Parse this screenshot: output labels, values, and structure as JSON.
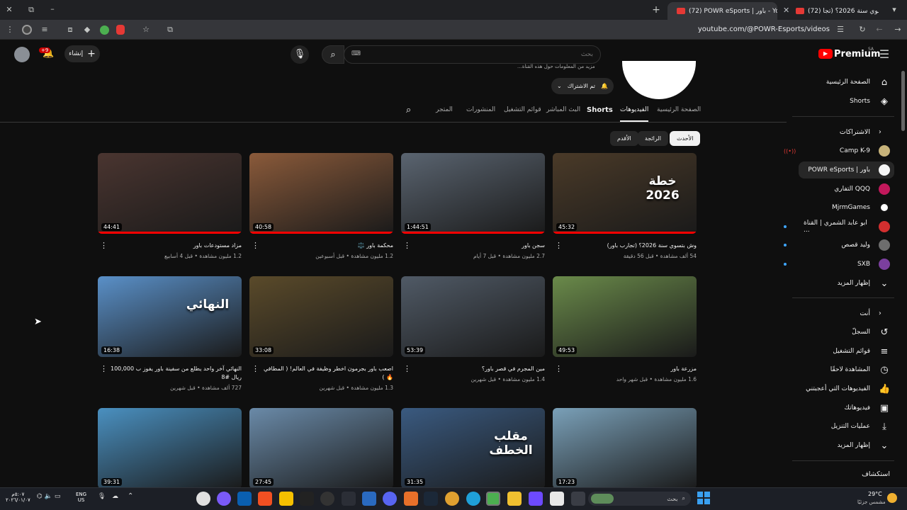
{
  "browser": {
    "tabs": [
      {
        "title": "(72) وش بتسوي سنة 2026؟ (تجا"
      },
      {
        "title": "(72) POWR eSports | باور - YouT"
      }
    ],
    "url": "youtube.com/@POWR-Esports/videos",
    "icons": [
      "back-icon",
      "reload-icon",
      "tab-search-icon",
      "star-icon",
      "extensions-icon"
    ]
  },
  "masthead": {
    "logo": "Premium",
    "logo_sup": "SA",
    "search_placeholder": "بحث",
    "search_kbd": "⌨",
    "create_label": "إنشاء",
    "notif_count": "+9"
  },
  "sidebar": {
    "main": [
      {
        "label": "الصفحة الرئيسية",
        "icon": "home-icon"
      },
      {
        "label": "Shorts",
        "icon": "shorts-icon"
      }
    ],
    "subs_header": "الاشتراكات",
    "subs": [
      {
        "label": "Camp K-9",
        "live": true,
        "dot": false,
        "color": "#c7b37a"
      },
      {
        "label": "POWR eSports | باور",
        "live": false,
        "dot": false,
        "color": "#f5f5f5"
      },
      {
        "label": "التفاري QQQ",
        "live": false,
        "dot": false,
        "color": "#c2185b"
      },
      {
        "label": "MjrmGames",
        "live": false,
        "dot": false,
        "color": "#ffffff"
      },
      {
        "label": "ابو عابد الشمري | القناة ...",
        "live": false,
        "dot": true,
        "color": "#d32f2f"
      },
      {
        "label": "وليد قصص",
        "live": false,
        "dot": true,
        "color": "#6d6d6d"
      },
      {
        "label": "SXB",
        "live": false,
        "dot": true,
        "color": "#7b3f9e"
      }
    ],
    "subs_more": "إظهار المزيد",
    "you_header": "أنت",
    "you": [
      {
        "label": "السجلّ",
        "icon": "history-icon"
      },
      {
        "label": "قوائم التشغيل",
        "icon": "playlists-icon"
      },
      {
        "label": "المشاهدة لاحقًا",
        "icon": "watch-later-icon"
      },
      {
        "label": "الفيديوهات التي أعجبتني",
        "icon": "like-icon"
      },
      {
        "label": "فيديوهاتك",
        "icon": "your-videos-icon"
      },
      {
        "label": "عمليات التنزيل",
        "icon": "download-icon"
      },
      {
        "label": "إظهار المزيد",
        "icon": "chevron-down-icon"
      }
    ],
    "explore_header": "استكشاف"
  },
  "channel": {
    "desc_snippet": "...مزيد من المعلومات حول هذه القناة",
    "subscribed_label": "تم الاشتراك",
    "tabs": [
      {
        "label": "الصفحة الرئيسية",
        "selected": false
      },
      {
        "label": "الفيديوهات",
        "selected": true
      },
      {
        "label": "Shorts",
        "selected": false
      },
      {
        "label": "البث المباشر",
        "selected": false
      },
      {
        "label": "قوائم التشغيل",
        "selected": false
      },
      {
        "label": "المنشورات",
        "selected": false
      },
      {
        "label": "المتجر",
        "selected": false
      }
    ],
    "chips": [
      {
        "label": "الأحدث",
        "selected": true
      },
      {
        "label": "الرائجة",
        "selected": false
      },
      {
        "label": "الأقدم",
        "selected": false
      }
    ]
  },
  "videos": [
    {
      "title": "وش بتسوي سنة 2026؟ (تجارب باور)",
      "meta": "54 ألف مشاهدة • قبل 56 دقيقة",
      "duration": "45:32",
      "bg": "#4a3a28",
      "progress": 1
    },
    {
      "title": "سجن باور",
      "meta": "2.7 مليون مشاهدة • قبل 7 أيام",
      "duration": "1:44:51",
      "bg": "#5a6470",
      "progress": 1
    },
    {
      "title": "محكمة باور ⚖️",
      "meta": "1.2 مليون مشاهدة • قبل أسبوعين",
      "duration": "40:58",
      "bg": "#8a5a3a",
      "progress": 1
    },
    {
      "title": "مزاد مستودعات باور",
      "meta": "1.2 مليون مشاهدة • قبل 4 أسابيع",
      "duration": "44:41",
      "bg": "#4a3530",
      "progress": 1
    },
    {
      "title": "مزرعة باور",
      "meta": "1.6 مليون مشاهدة • قبل شهر واحد",
      "duration": "49:53",
      "bg": "#6a8a4a",
      "progress": 0
    },
    {
      "title": "مين المجرم في قصر باور؟",
      "meta": "1.4 مليون مشاهدة • قبل شهرين",
      "duration": "53:39",
      "bg": "#505a66",
      "progress": 0
    },
    {
      "title": "اصعب باور بجرمون اخطر وظيفة في العالم! ( المطافي 🔥 )",
      "meta": "1.3 مليون مشاهدة • قبل شهرين",
      "duration": "33:08",
      "bg": "#5a4a2a",
      "progress": 0
    },
    {
      "title": "النهائي آخر واحد يطلع من سفينة باور يفوز ب 100,000 ريال #8",
      "meta": "727 ألف مشاهدة • قبل شهرين",
      "duration": "16:38",
      "bg": "#5a90c8",
      "progress": 0
    },
    {
      "title": "",
      "meta": "",
      "duration": "17:23",
      "bg": "#7aa0b8",
      "progress": 0
    },
    {
      "title": "",
      "meta": "",
      "duration": "31:35",
      "bg": "#3a5a80",
      "progress": 0
    },
    {
      "title": "",
      "meta": "",
      "duration": "27:45",
      "bg": "#6a8aa8",
      "progress": 0
    },
    {
      "title": "",
      "meta": "",
      "duration": "39:31",
      "bg": "#4a90c0",
      "progress": 0
    }
  ],
  "thumb_overlays": {
    "v0": "خطة 2026",
    "v7": "النهائي",
    "v9": "مقلب الخطف"
  },
  "taskbar": {
    "weather_temp": "29°C",
    "weather_desc": "مشمس جزئيًا",
    "search_placeholder": "بحث",
    "lang_top": "ENG",
    "lang_bottom": "US",
    "clock_time": "٥:٠٧م",
    "clock_date": "٢٠٢٦/٠١/٠٧"
  }
}
